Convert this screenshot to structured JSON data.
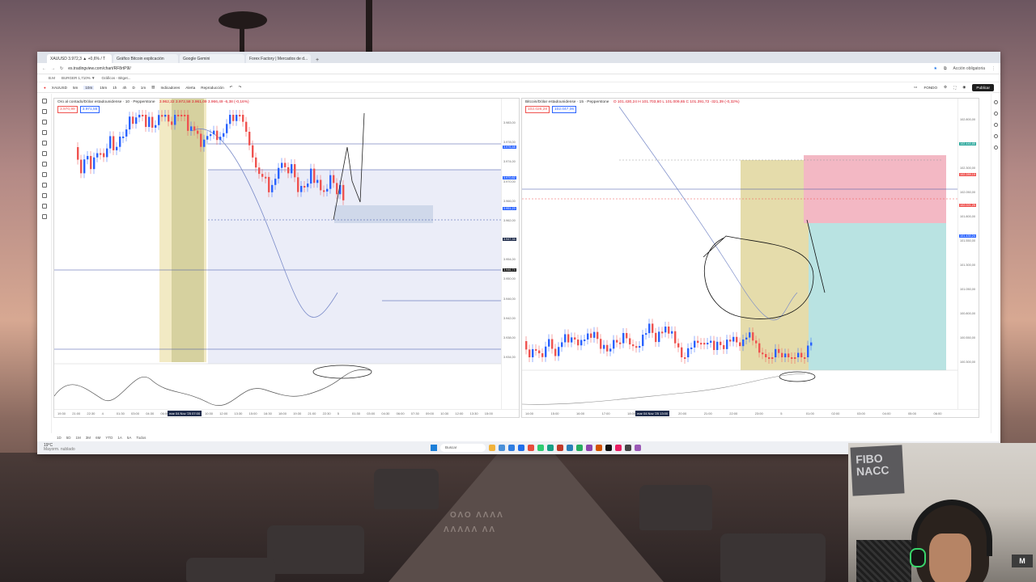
{
  "browser": {
    "tabs": [
      {
        "label": "XAUUSD 3.972,3 ▲ +0,6% / T",
        "active": true
      },
      {
        "label": "Gráfico Bitcoin explicación",
        "active": false
      },
      {
        "label": "Google Gemini",
        "active": false
      },
      {
        "label": "Forex Factory | Mercados de d...",
        "active": false
      }
    ],
    "new_tab": "+",
    "url": "es.tradingview.com/chart/RF8rtP9l/",
    "profile_label": "Acción obligatoria",
    "bookmarks": [
      "B.M",
      "BURGER 1,710% ▼",
      "Gráficos - Bitget..."
    ]
  },
  "toolbar": {
    "symbol": "XAUUSD",
    "timeframes": [
      "5m",
      "10m",
      "15m",
      "1h",
      "4h",
      "D",
      "1m"
    ],
    "indicators_label": "Indicadores",
    "alert_label": "Alerta",
    "replay_label": "Reproducción",
    "layout_label": "FONDO",
    "publish_label": "Publicar"
  },
  "left_chart": {
    "title": "Oro al contado/Dólar estadounidense · 10 · Pepperstone",
    "ohlc": "3.962,22 3.972,58 3.961,09 3.966,49 -6,38 (-0,16%)",
    "bid": "3.970,99",
    "ask": "3.971,55",
    "price_ticks": [
      "3.983,00",
      "3.978,00",
      "3.974,00",
      "3.970,00",
      "3.966,00",
      "3.962,00",
      "3.958,00",
      "3.954,00",
      "3.950,00",
      "3.946,00",
      "3.942,00",
      "3.938,00",
      "3.934,00"
    ],
    "price_badges": [
      {
        "label": "3.976,48",
        "color": "#2962ff"
      },
      {
        "label": "3.970,82",
        "color": "#2962ff"
      },
      {
        "label": "3.951,23",
        "color": "#2962ff"
      },
      {
        "label": "3.947,34",
        "color": "#1e2b4a"
      },
      {
        "label": "3.946,74",
        "color": "#111111"
      }
    ],
    "time_ticks": [
      "19:30",
      "21:00",
      "22:30",
      "4",
      "01:30",
      "03:00",
      "04:30",
      "06:00",
      "07:30",
      "09:00",
      "10:30",
      "12:00",
      "13:30",
      "15:00",
      "16:30",
      "18:00",
      "19:30",
      "21:00",
      "22:30",
      "5",
      "01:30",
      "03:00",
      "04:30",
      "06:00",
      "07:30",
      "09:00",
      "10:30",
      "12:00",
      "13:30",
      "15:00"
    ],
    "time_badge": "mar 04 Nov '25  07:00",
    "osc_ticks": [
      "80,00",
      "60,00",
      "40,00",
      "20,00"
    ]
  },
  "right_chart": {
    "title": "Bitcoin/Dólar estadounidense · 15 · Pepperstone",
    "ohlc": "O 101.430,24 H 101.703,60 L 101.009,65 C 101.391,72 -321,39 (-0,32%)",
    "bid": "102.026,28",
    "ask": "102.047,06",
    "price_ticks": [
      "102.800,00",
      "102.550,00",
      "102.300,00",
      "102.050,00",
      "101.800,00",
      "101.550,00",
      "101.300,00",
      "101.050,00",
      "100.800,00",
      "100.550,00",
      "100.300,00"
    ],
    "price_badges": [
      {
        "label": "102.440,85",
        "color": "#26a69a"
      },
      {
        "label": "102.289,19",
        "color": "#ef5350"
      },
      {
        "label": "102.021,25",
        "color": "#ef5350"
      },
      {
        "label": "101.430,24",
        "color": "#2962ff"
      }
    ],
    "time_ticks": [
      "14:00",
      "15:00",
      "16:00",
      "17:00",
      "18:00",
      "19:00",
      "20:00",
      "21:00",
      "22:00",
      "23:00",
      "5",
      "01:00",
      "02:00",
      "03:00",
      "04:00",
      "05:00",
      "06:00"
    ],
    "time_badge": "mar 04 Nov '25  13:00",
    "clock": "23:51:50 UTC-5",
    "osc_ticks": [
      "80,00",
      "60,00"
    ]
  },
  "bottom": {
    "ranges": [
      "1D",
      "5D",
      "1M",
      "3M",
      "6M",
      "YTD",
      "1A",
      "5A",
      "Todos"
    ],
    "panels": [
      "Editor de Pine",
      "Panel de trading"
    ]
  },
  "taskbar": {
    "weather_temp": "19°C",
    "weather_desc": "Mayorm. nublado",
    "search": "Buscar"
  },
  "webcam": {
    "sign_text": "FIBO\nNACC",
    "logo": "M"
  },
  "colors": {
    "bull": "#2962ff",
    "bear": "#ef5350",
    "zone_yellow": "#e7dfa9",
    "zone_red": "#f3b8c4",
    "zone_teal": "#b9e3e2"
  }
}
